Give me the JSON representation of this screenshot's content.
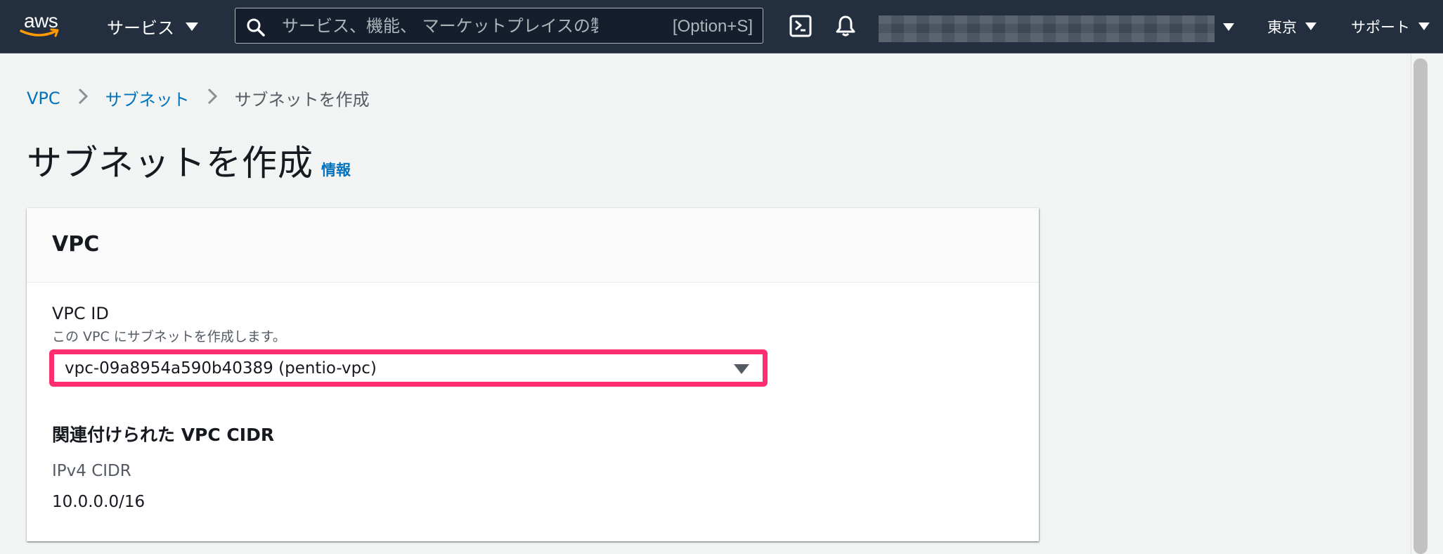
{
  "topnav": {
    "logo_text": "aws",
    "services_label": "サービス",
    "search_placeholder": "サービス、機能、 マーケットプレイスの製品、",
    "search_shortcut": "[Option+S]",
    "region_label": "東京",
    "support_label": "サポート",
    "icons": [
      "aws-logo",
      "search-icon",
      "cloudshell-icon",
      "bell-icon",
      "chevron-down-icon"
    ]
  },
  "breadcrumb": {
    "items": [
      "VPC",
      "サブネット",
      "サブネットを作成"
    ]
  },
  "page": {
    "title": "サブネットを作成",
    "info_link": "情報"
  },
  "vpc_section": {
    "title": "VPC",
    "vpc_id_label": "VPC ID",
    "vpc_id_description": "この VPC にサブネットを作成します。",
    "vpc_id_selected": "vpc-09a8954a590b40389 (pentio-vpc)",
    "cidr_section_title": "関連付けられた VPC CIDR",
    "ipv4_cidr_label": "IPv4 CIDR",
    "ipv4_cidr_value": "10.0.0.0/16"
  },
  "colors": {
    "nav_background": "#232f3e",
    "link": "#0073bb",
    "highlight": "#ff2e6e",
    "page_background": "#f2f3f3"
  }
}
